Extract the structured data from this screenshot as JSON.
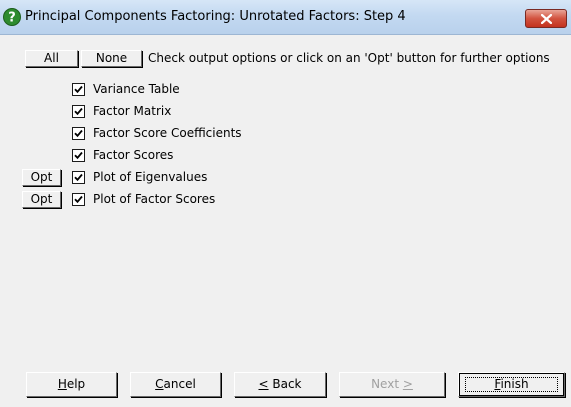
{
  "window": {
    "title": "Principal Components Factoring: Unrotated Factors: Step 4"
  },
  "toolbar": {
    "all_label": "All",
    "none_label": "None",
    "hint": "Check output options or click on an 'Opt' button for further options"
  },
  "options": [
    {
      "label": "Variance Table",
      "checked": true,
      "has_opt": false
    },
    {
      "label": "Factor Matrix",
      "checked": true,
      "has_opt": false
    },
    {
      "label": "Factor Score Coefficients",
      "checked": true,
      "has_opt": false
    },
    {
      "label": "Factor Scores",
      "checked": true,
      "has_opt": false
    },
    {
      "label": "Plot of Eigenvalues",
      "checked": true,
      "has_opt": true
    },
    {
      "label": "Plot of Factor Scores",
      "checked": true,
      "has_opt": true
    }
  ],
  "opt_label": "Opt",
  "footer": {
    "help": {
      "pre": "",
      "key": "H",
      "post": "elp"
    },
    "cancel": {
      "pre": "",
      "key": "C",
      "post": "ancel"
    },
    "back": {
      "pre": "",
      "key": "<",
      "post": " Back"
    },
    "next": {
      "pre": "Next ",
      "key": ">",
      "post": ""
    },
    "finish": {
      "pre": "",
      "key": "F",
      "post": "inish"
    }
  },
  "icons": {
    "help": "question-icon",
    "close": "close-icon",
    "check": "check-icon"
  },
  "colors": {
    "close_button": "#c3321f",
    "help_icon": "#2e8b2e",
    "titlebar": "#c3d9f1",
    "disabled_text": "#a0a0a0"
  }
}
